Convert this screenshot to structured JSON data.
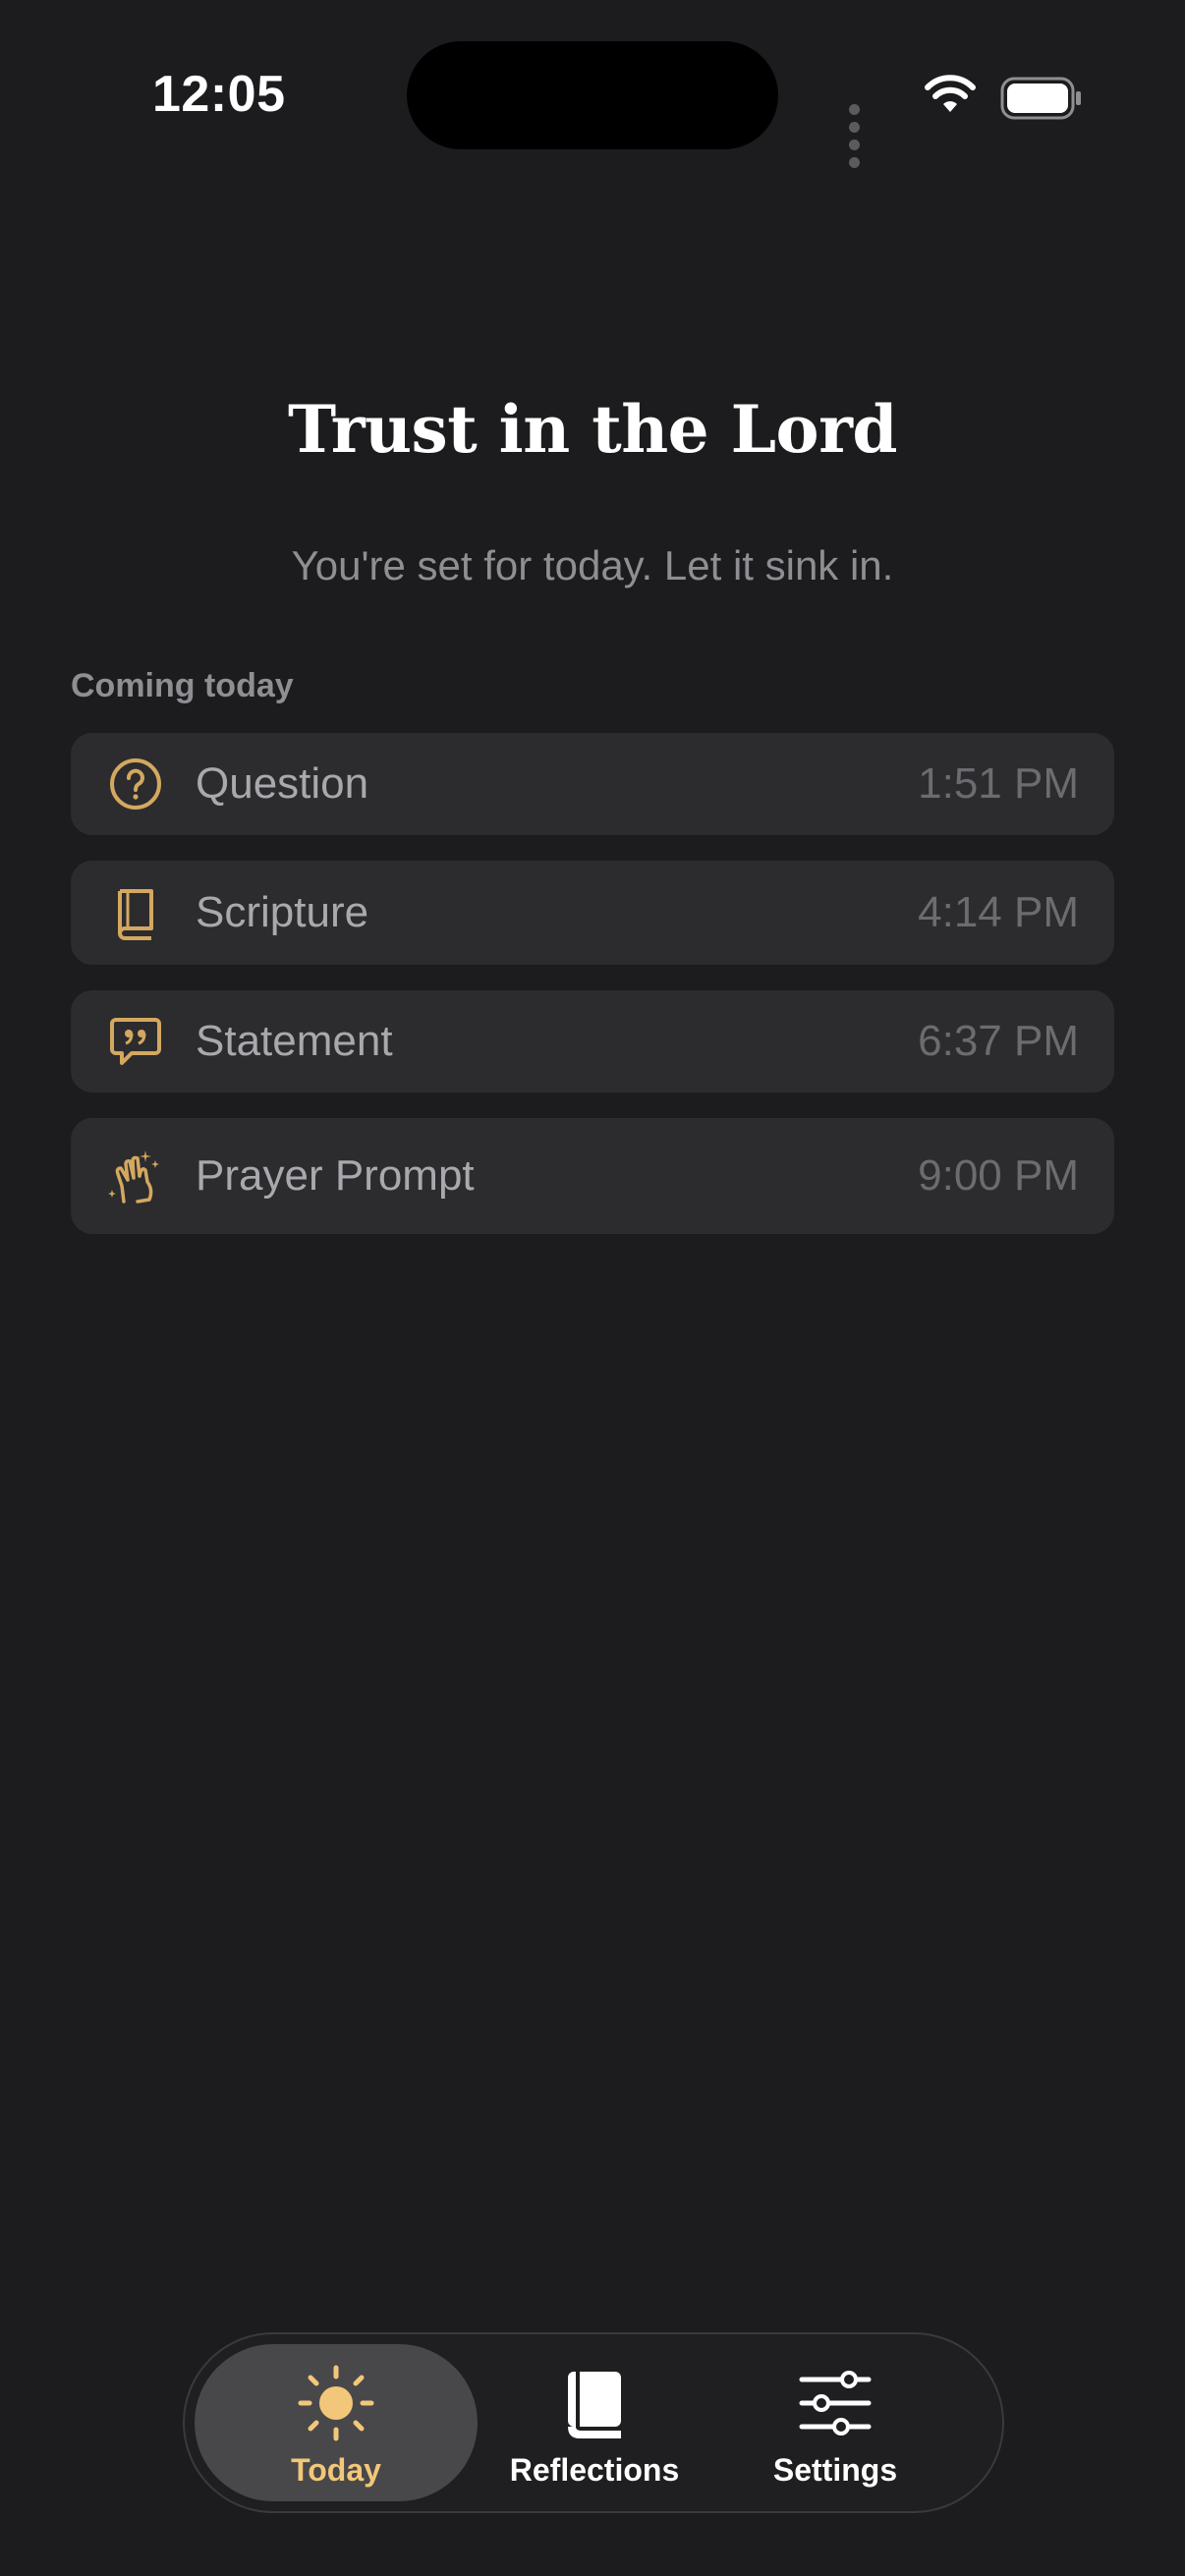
{
  "status_bar": {
    "time": "12:05"
  },
  "header": {
    "title": "Trust in the Lord",
    "subtitle": "You're set for today. Let it sink in."
  },
  "schedule": {
    "section_label": "Coming today",
    "items": [
      {
        "icon": "question-circle-icon",
        "label": "Question",
        "time": "1:51 PM"
      },
      {
        "icon": "book-icon",
        "label": "Scripture",
        "time": "4:14 PM"
      },
      {
        "icon": "quote-bubble-icon",
        "label": "Statement",
        "time": "6:37 PM"
      },
      {
        "icon": "praying-hands-icon",
        "label": "Prayer Prompt",
        "time": "9:00 PM"
      }
    ]
  },
  "tab_bar": {
    "tabs": [
      {
        "icon": "sun-icon",
        "label": "Today",
        "active": true
      },
      {
        "icon": "book-icon",
        "label": "Reflections",
        "active": false
      },
      {
        "icon": "sliders-icon",
        "label": "Settings",
        "active": false
      }
    ]
  },
  "colors": {
    "background": "#1c1c1e",
    "card": "#2c2c2e",
    "accent": "#d4a860",
    "active_tab_label": "#f2c77a"
  }
}
